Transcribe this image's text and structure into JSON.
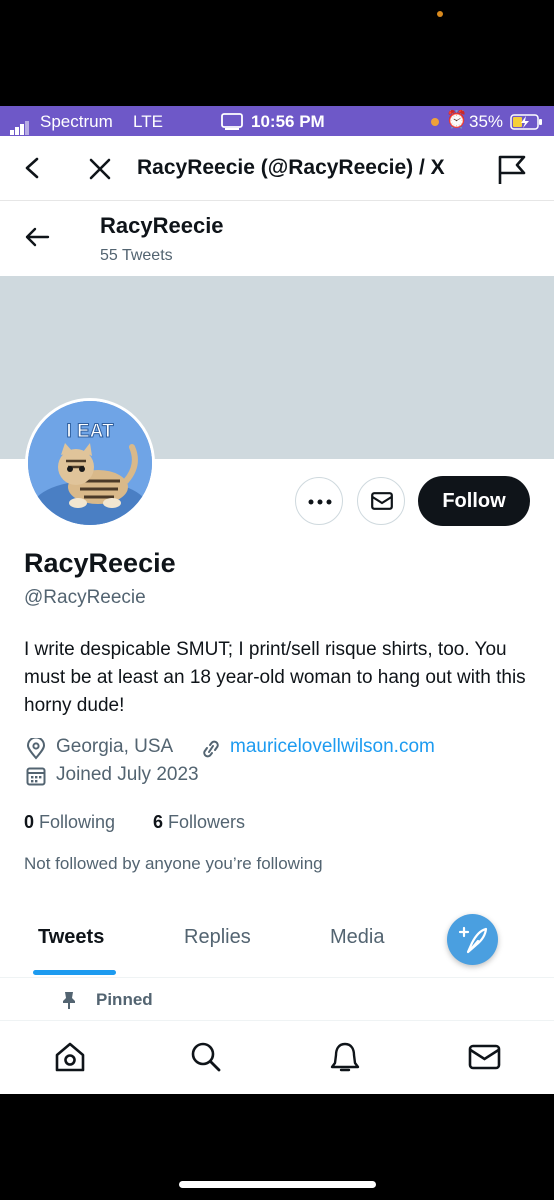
{
  "status_bar": {
    "carrier": "Spectrum",
    "network": "LTE",
    "time": "10:56 PM",
    "battery": "35%"
  },
  "browser": {
    "title": "RacyReecie (@RacyReecie) / X"
  },
  "header": {
    "name": "RacyReecie",
    "tweet_count": "55 Tweets"
  },
  "profile": {
    "display_name": "RacyReecie",
    "handle": "@RacyReecie",
    "bio": "I write despicable SMUT; I print/sell risque shirts, too. You must be at least an 18 year-old woman to hang out with this horny dude!",
    "location": "Georgia, USA",
    "website": "mauricelovellwilson.com",
    "joined": "Joined July 2023",
    "following_count": "0",
    "following_label": "Following",
    "followers_count": "6",
    "followers_label": "Followers",
    "not_followed": "Not followed by anyone you’re following",
    "follow_label": "Follow",
    "avatar_text": "I EAT"
  },
  "tabs": [
    {
      "label": "Tweets"
    },
    {
      "label": "Replies"
    },
    {
      "label": "Media"
    }
  ],
  "pinned_label": "Pinned",
  "colors": {
    "accent": "#1d9bf0",
    "status_bar": "#6e58c8",
    "banner": "#cfd9de"
  },
  "icons": [
    "back-chevron-icon",
    "close-icon",
    "flag-icon",
    "back-arrow-icon",
    "more-icon",
    "mail-icon",
    "location-icon",
    "link-icon",
    "calendar-icon",
    "pin-icon",
    "compose-icon",
    "home-icon",
    "search-icon",
    "notifications-icon",
    "messages-icon"
  ]
}
